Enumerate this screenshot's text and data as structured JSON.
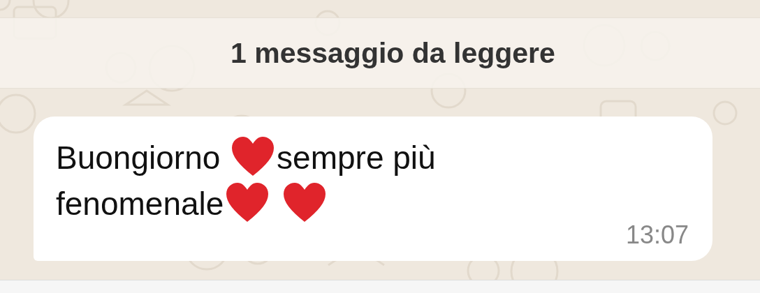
{
  "unread_banner": {
    "text": "1 messaggio da leggere"
  },
  "message": {
    "segments": [
      {
        "kind": "text",
        "text": "Buongiorno "
      },
      {
        "kind": "heart"
      },
      {
        "kind": "text",
        "text": "sempre più"
      },
      {
        "kind": "break"
      },
      {
        "kind": "text",
        "text": "fenomenale"
      },
      {
        "kind": "heart"
      },
      {
        "kind": "space"
      },
      {
        "kind": "heart"
      }
    ],
    "time": "13:07"
  }
}
